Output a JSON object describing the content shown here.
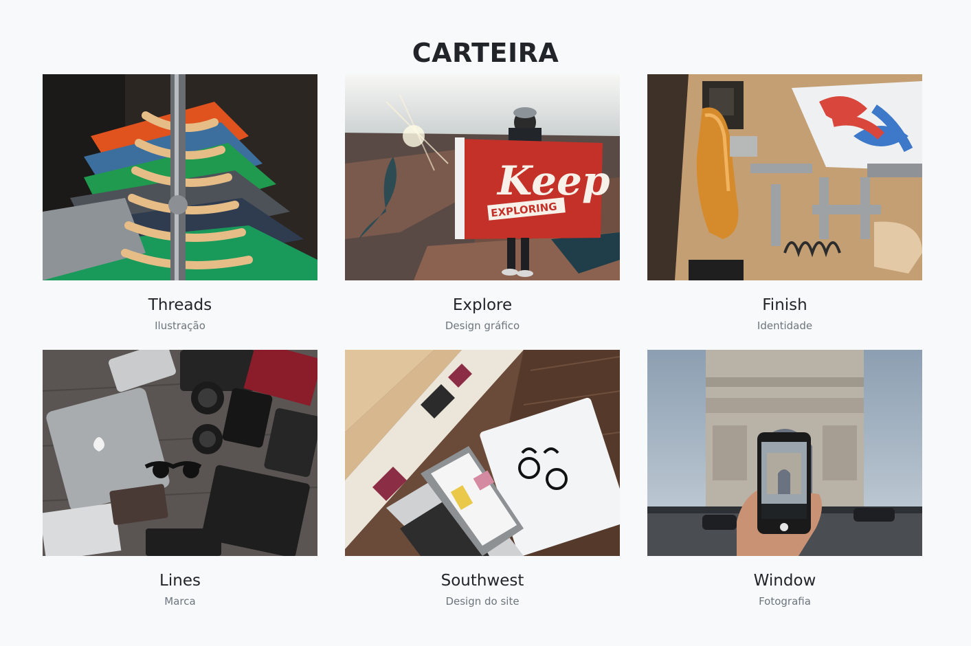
{
  "portfolio": {
    "title": "CARTEIRA",
    "items": [
      {
        "title": "Threads",
        "category": "Ilustração",
        "image": "clothes-rack-photo"
      },
      {
        "title": "Explore",
        "category": "Design gráfico",
        "image": "keep-exploring-flag-photo"
      },
      {
        "title": "Finish",
        "category": "Identidade",
        "image": "workshop-desk-photo"
      },
      {
        "title": "Lines",
        "category": "Marca",
        "image": "tech-gear-flatlay-photo"
      },
      {
        "title": "Southwest",
        "category": "Design do site",
        "image": "laptop-notebook-desk-photo"
      },
      {
        "title": "Window",
        "category": "Fotografia",
        "image": "arc-de-triomphe-phone-photo"
      }
    ],
    "flag_text": {
      "line1": "Keep",
      "line2": "EXPLORING"
    }
  },
  "colors": {
    "background": "#f8f9fa",
    "heading": "#212529",
    "muted": "#6c757d"
  }
}
